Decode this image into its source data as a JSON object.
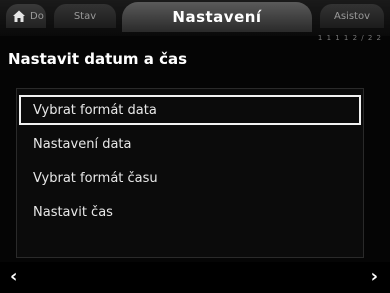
{
  "tabs": {
    "home_label": "Do",
    "status_label": "Stav",
    "settings_label": "Nastavení",
    "assist_label": "Asistov"
  },
  "indicator": "1 1 1 1 2 / 2 2",
  "page_title": "Nastavit datum a čas",
  "menu": {
    "items": [
      {
        "label": "Vybrat formát data"
      },
      {
        "label": "Nastavení data"
      },
      {
        "label": "Vybrat formát času"
      },
      {
        "label": "Nastavit čas"
      }
    ]
  },
  "nav": {
    "prev_glyph": "‹",
    "next_glyph": "›"
  }
}
